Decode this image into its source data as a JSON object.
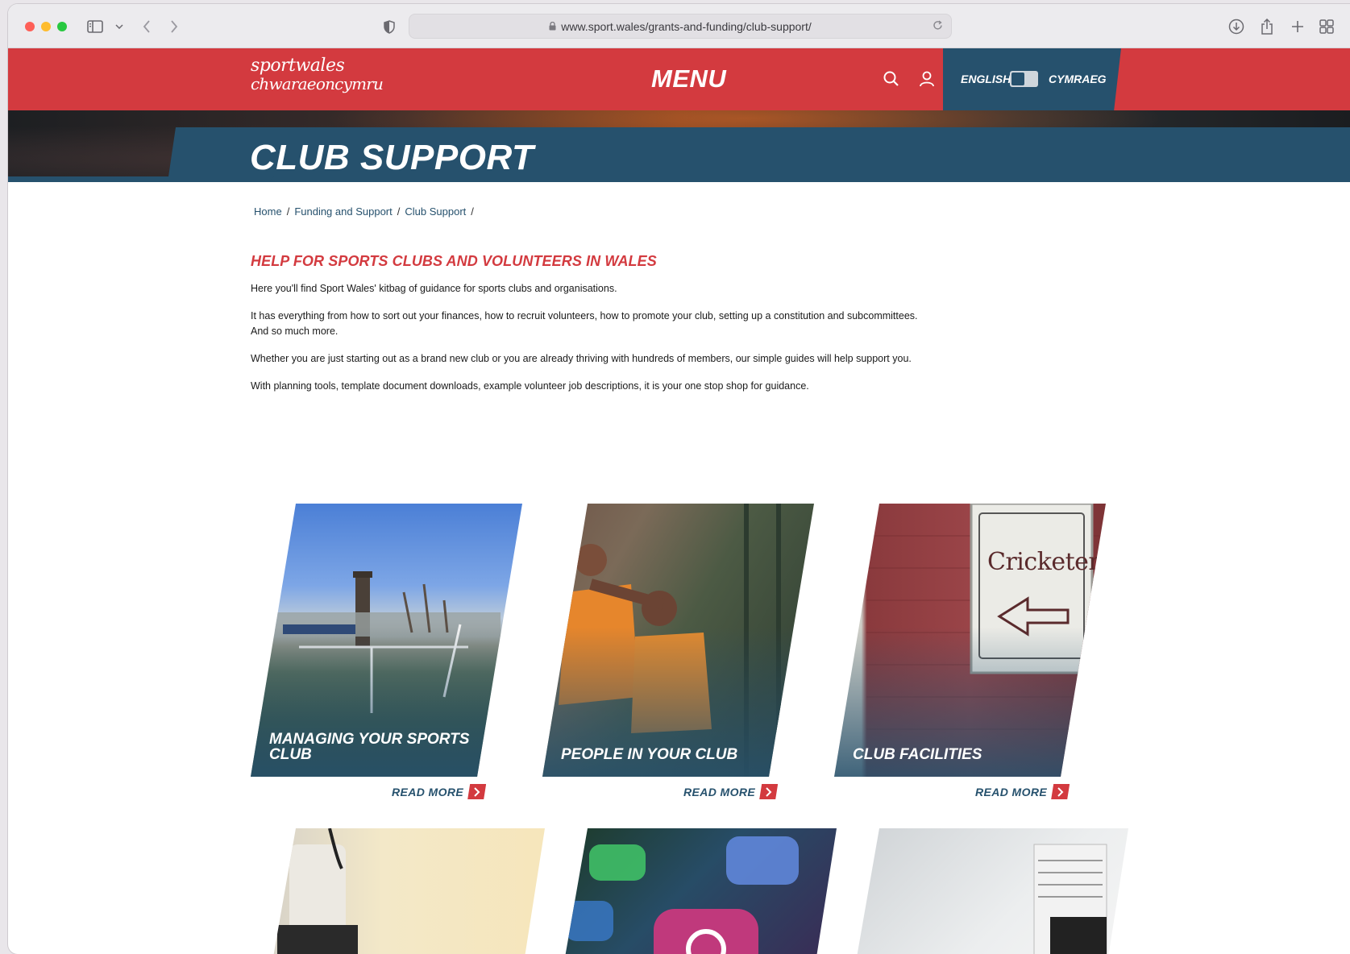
{
  "browser": {
    "url": "www.sport.wales/grants-and-funding/club-support/"
  },
  "header": {
    "logo_line1": "sportwales",
    "logo_line2": "chwaraeoncymru",
    "menu_label": "MENU",
    "lang_english": "ENGLISH",
    "lang_welsh": "CYMRAEG"
  },
  "hero": {
    "title": "CLUB SUPPORT"
  },
  "breadcrumb": [
    {
      "label": "Home"
    },
    {
      "label": "Funding and Support"
    },
    {
      "label": "Club Support"
    }
  ],
  "breadcrumb_sep": "/",
  "content": {
    "heading": "HELP FOR SPORTS CLUBS AND VOLUNTEERS IN WALES",
    "paragraphs": [
      "Here you'll find Sport Wales' kitbag of guidance for sports clubs and organisations.",
      "It has everything from how to sort out your finances, how to recruit volunteers, how to promote your club, setting up a constitution and subcommittees. And so much more.",
      "Whether you are just starting out as a brand new club or you are already thriving with hundreds of members, our simple guides will help support you.",
      "With planning tools, template document downloads, example volunteer job descriptions, it is your one stop shop for guidance."
    ]
  },
  "cards": [
    {
      "title": "MANAGING YOUR SPORTS CLUB",
      "read_more": "READ MORE"
    },
    {
      "title": "PEOPLE IN YOUR CLUB",
      "read_more": "READ MORE"
    },
    {
      "title": "CLUB FACILITIES",
      "read_more": "READ MORE"
    }
  ],
  "sign_text": "Cricketers",
  "colors": {
    "brand_red": "#d33a3f",
    "brand_blue": "#26516d"
  }
}
